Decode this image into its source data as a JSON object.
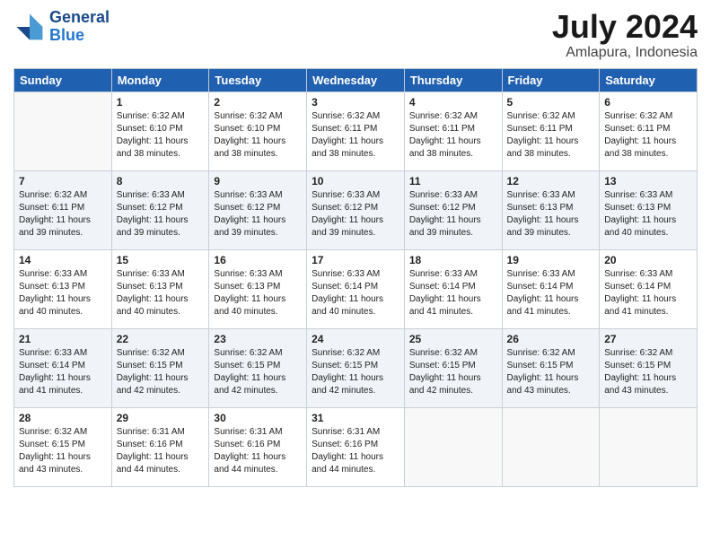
{
  "logo": {
    "text_line1": "General",
    "text_line2": "Blue"
  },
  "title": "July 2024",
  "location": "Amlapura, Indonesia",
  "days_header": [
    "Sunday",
    "Monday",
    "Tuesday",
    "Wednesday",
    "Thursday",
    "Friday",
    "Saturday"
  ],
  "weeks": [
    [
      {
        "day": "",
        "sunrise": "",
        "sunset": "",
        "daylight": ""
      },
      {
        "day": "1",
        "sunrise": "Sunrise: 6:32 AM",
        "sunset": "Sunset: 6:10 PM",
        "daylight": "Daylight: 11 hours and 38 minutes."
      },
      {
        "day": "2",
        "sunrise": "Sunrise: 6:32 AM",
        "sunset": "Sunset: 6:10 PM",
        "daylight": "Daylight: 11 hours and 38 minutes."
      },
      {
        "day": "3",
        "sunrise": "Sunrise: 6:32 AM",
        "sunset": "Sunset: 6:11 PM",
        "daylight": "Daylight: 11 hours and 38 minutes."
      },
      {
        "day": "4",
        "sunrise": "Sunrise: 6:32 AM",
        "sunset": "Sunset: 6:11 PM",
        "daylight": "Daylight: 11 hours and 38 minutes."
      },
      {
        "day": "5",
        "sunrise": "Sunrise: 6:32 AM",
        "sunset": "Sunset: 6:11 PM",
        "daylight": "Daylight: 11 hours and 38 minutes."
      },
      {
        "day": "6",
        "sunrise": "Sunrise: 6:32 AM",
        "sunset": "Sunset: 6:11 PM",
        "daylight": "Daylight: 11 hours and 38 minutes."
      }
    ],
    [
      {
        "day": "7",
        "sunrise": "Sunrise: 6:32 AM",
        "sunset": "Sunset: 6:11 PM",
        "daylight": "Daylight: 11 hours and 39 minutes."
      },
      {
        "day": "8",
        "sunrise": "Sunrise: 6:33 AM",
        "sunset": "Sunset: 6:12 PM",
        "daylight": "Daylight: 11 hours and 39 minutes."
      },
      {
        "day": "9",
        "sunrise": "Sunrise: 6:33 AM",
        "sunset": "Sunset: 6:12 PM",
        "daylight": "Daylight: 11 hours and 39 minutes."
      },
      {
        "day": "10",
        "sunrise": "Sunrise: 6:33 AM",
        "sunset": "Sunset: 6:12 PM",
        "daylight": "Daylight: 11 hours and 39 minutes."
      },
      {
        "day": "11",
        "sunrise": "Sunrise: 6:33 AM",
        "sunset": "Sunset: 6:12 PM",
        "daylight": "Daylight: 11 hours and 39 minutes."
      },
      {
        "day": "12",
        "sunrise": "Sunrise: 6:33 AM",
        "sunset": "Sunset: 6:13 PM",
        "daylight": "Daylight: 11 hours and 39 minutes."
      },
      {
        "day": "13",
        "sunrise": "Sunrise: 6:33 AM",
        "sunset": "Sunset: 6:13 PM",
        "daylight": "Daylight: 11 hours and 40 minutes."
      }
    ],
    [
      {
        "day": "14",
        "sunrise": "Sunrise: 6:33 AM",
        "sunset": "Sunset: 6:13 PM",
        "daylight": "Daylight: 11 hours and 40 minutes."
      },
      {
        "day": "15",
        "sunrise": "Sunrise: 6:33 AM",
        "sunset": "Sunset: 6:13 PM",
        "daylight": "Daylight: 11 hours and 40 minutes."
      },
      {
        "day": "16",
        "sunrise": "Sunrise: 6:33 AM",
        "sunset": "Sunset: 6:13 PM",
        "daylight": "Daylight: 11 hours and 40 minutes."
      },
      {
        "day": "17",
        "sunrise": "Sunrise: 6:33 AM",
        "sunset": "Sunset: 6:14 PM",
        "daylight": "Daylight: 11 hours and 40 minutes."
      },
      {
        "day": "18",
        "sunrise": "Sunrise: 6:33 AM",
        "sunset": "Sunset: 6:14 PM",
        "daylight": "Daylight: 11 hours and 41 minutes."
      },
      {
        "day": "19",
        "sunrise": "Sunrise: 6:33 AM",
        "sunset": "Sunset: 6:14 PM",
        "daylight": "Daylight: 11 hours and 41 minutes."
      },
      {
        "day": "20",
        "sunrise": "Sunrise: 6:33 AM",
        "sunset": "Sunset: 6:14 PM",
        "daylight": "Daylight: 11 hours and 41 minutes."
      }
    ],
    [
      {
        "day": "21",
        "sunrise": "Sunrise: 6:33 AM",
        "sunset": "Sunset: 6:14 PM",
        "daylight": "Daylight: 11 hours and 41 minutes."
      },
      {
        "day": "22",
        "sunrise": "Sunrise: 6:32 AM",
        "sunset": "Sunset: 6:15 PM",
        "daylight": "Daylight: 11 hours and 42 minutes."
      },
      {
        "day": "23",
        "sunrise": "Sunrise: 6:32 AM",
        "sunset": "Sunset: 6:15 PM",
        "daylight": "Daylight: 11 hours and 42 minutes."
      },
      {
        "day": "24",
        "sunrise": "Sunrise: 6:32 AM",
        "sunset": "Sunset: 6:15 PM",
        "daylight": "Daylight: 11 hours and 42 minutes."
      },
      {
        "day": "25",
        "sunrise": "Sunrise: 6:32 AM",
        "sunset": "Sunset: 6:15 PM",
        "daylight": "Daylight: 11 hours and 42 minutes."
      },
      {
        "day": "26",
        "sunrise": "Sunrise: 6:32 AM",
        "sunset": "Sunset: 6:15 PM",
        "daylight": "Daylight: 11 hours and 43 minutes."
      },
      {
        "day": "27",
        "sunrise": "Sunrise: 6:32 AM",
        "sunset": "Sunset: 6:15 PM",
        "daylight": "Daylight: 11 hours and 43 minutes."
      }
    ],
    [
      {
        "day": "28",
        "sunrise": "Sunrise: 6:32 AM",
        "sunset": "Sunset: 6:15 PM",
        "daylight": "Daylight: 11 hours and 43 minutes."
      },
      {
        "day": "29",
        "sunrise": "Sunrise: 6:31 AM",
        "sunset": "Sunset: 6:16 PM",
        "daylight": "Daylight: 11 hours and 44 minutes."
      },
      {
        "day": "30",
        "sunrise": "Sunrise: 6:31 AM",
        "sunset": "Sunset: 6:16 PM",
        "daylight": "Daylight: 11 hours and 44 minutes."
      },
      {
        "day": "31",
        "sunrise": "Sunrise: 6:31 AM",
        "sunset": "Sunset: 6:16 PM",
        "daylight": "Daylight: 11 hours and 44 minutes."
      },
      {
        "day": "",
        "sunrise": "",
        "sunset": "",
        "daylight": ""
      },
      {
        "day": "",
        "sunrise": "",
        "sunset": "",
        "daylight": ""
      },
      {
        "day": "",
        "sunrise": "",
        "sunset": "",
        "daylight": ""
      }
    ]
  ]
}
